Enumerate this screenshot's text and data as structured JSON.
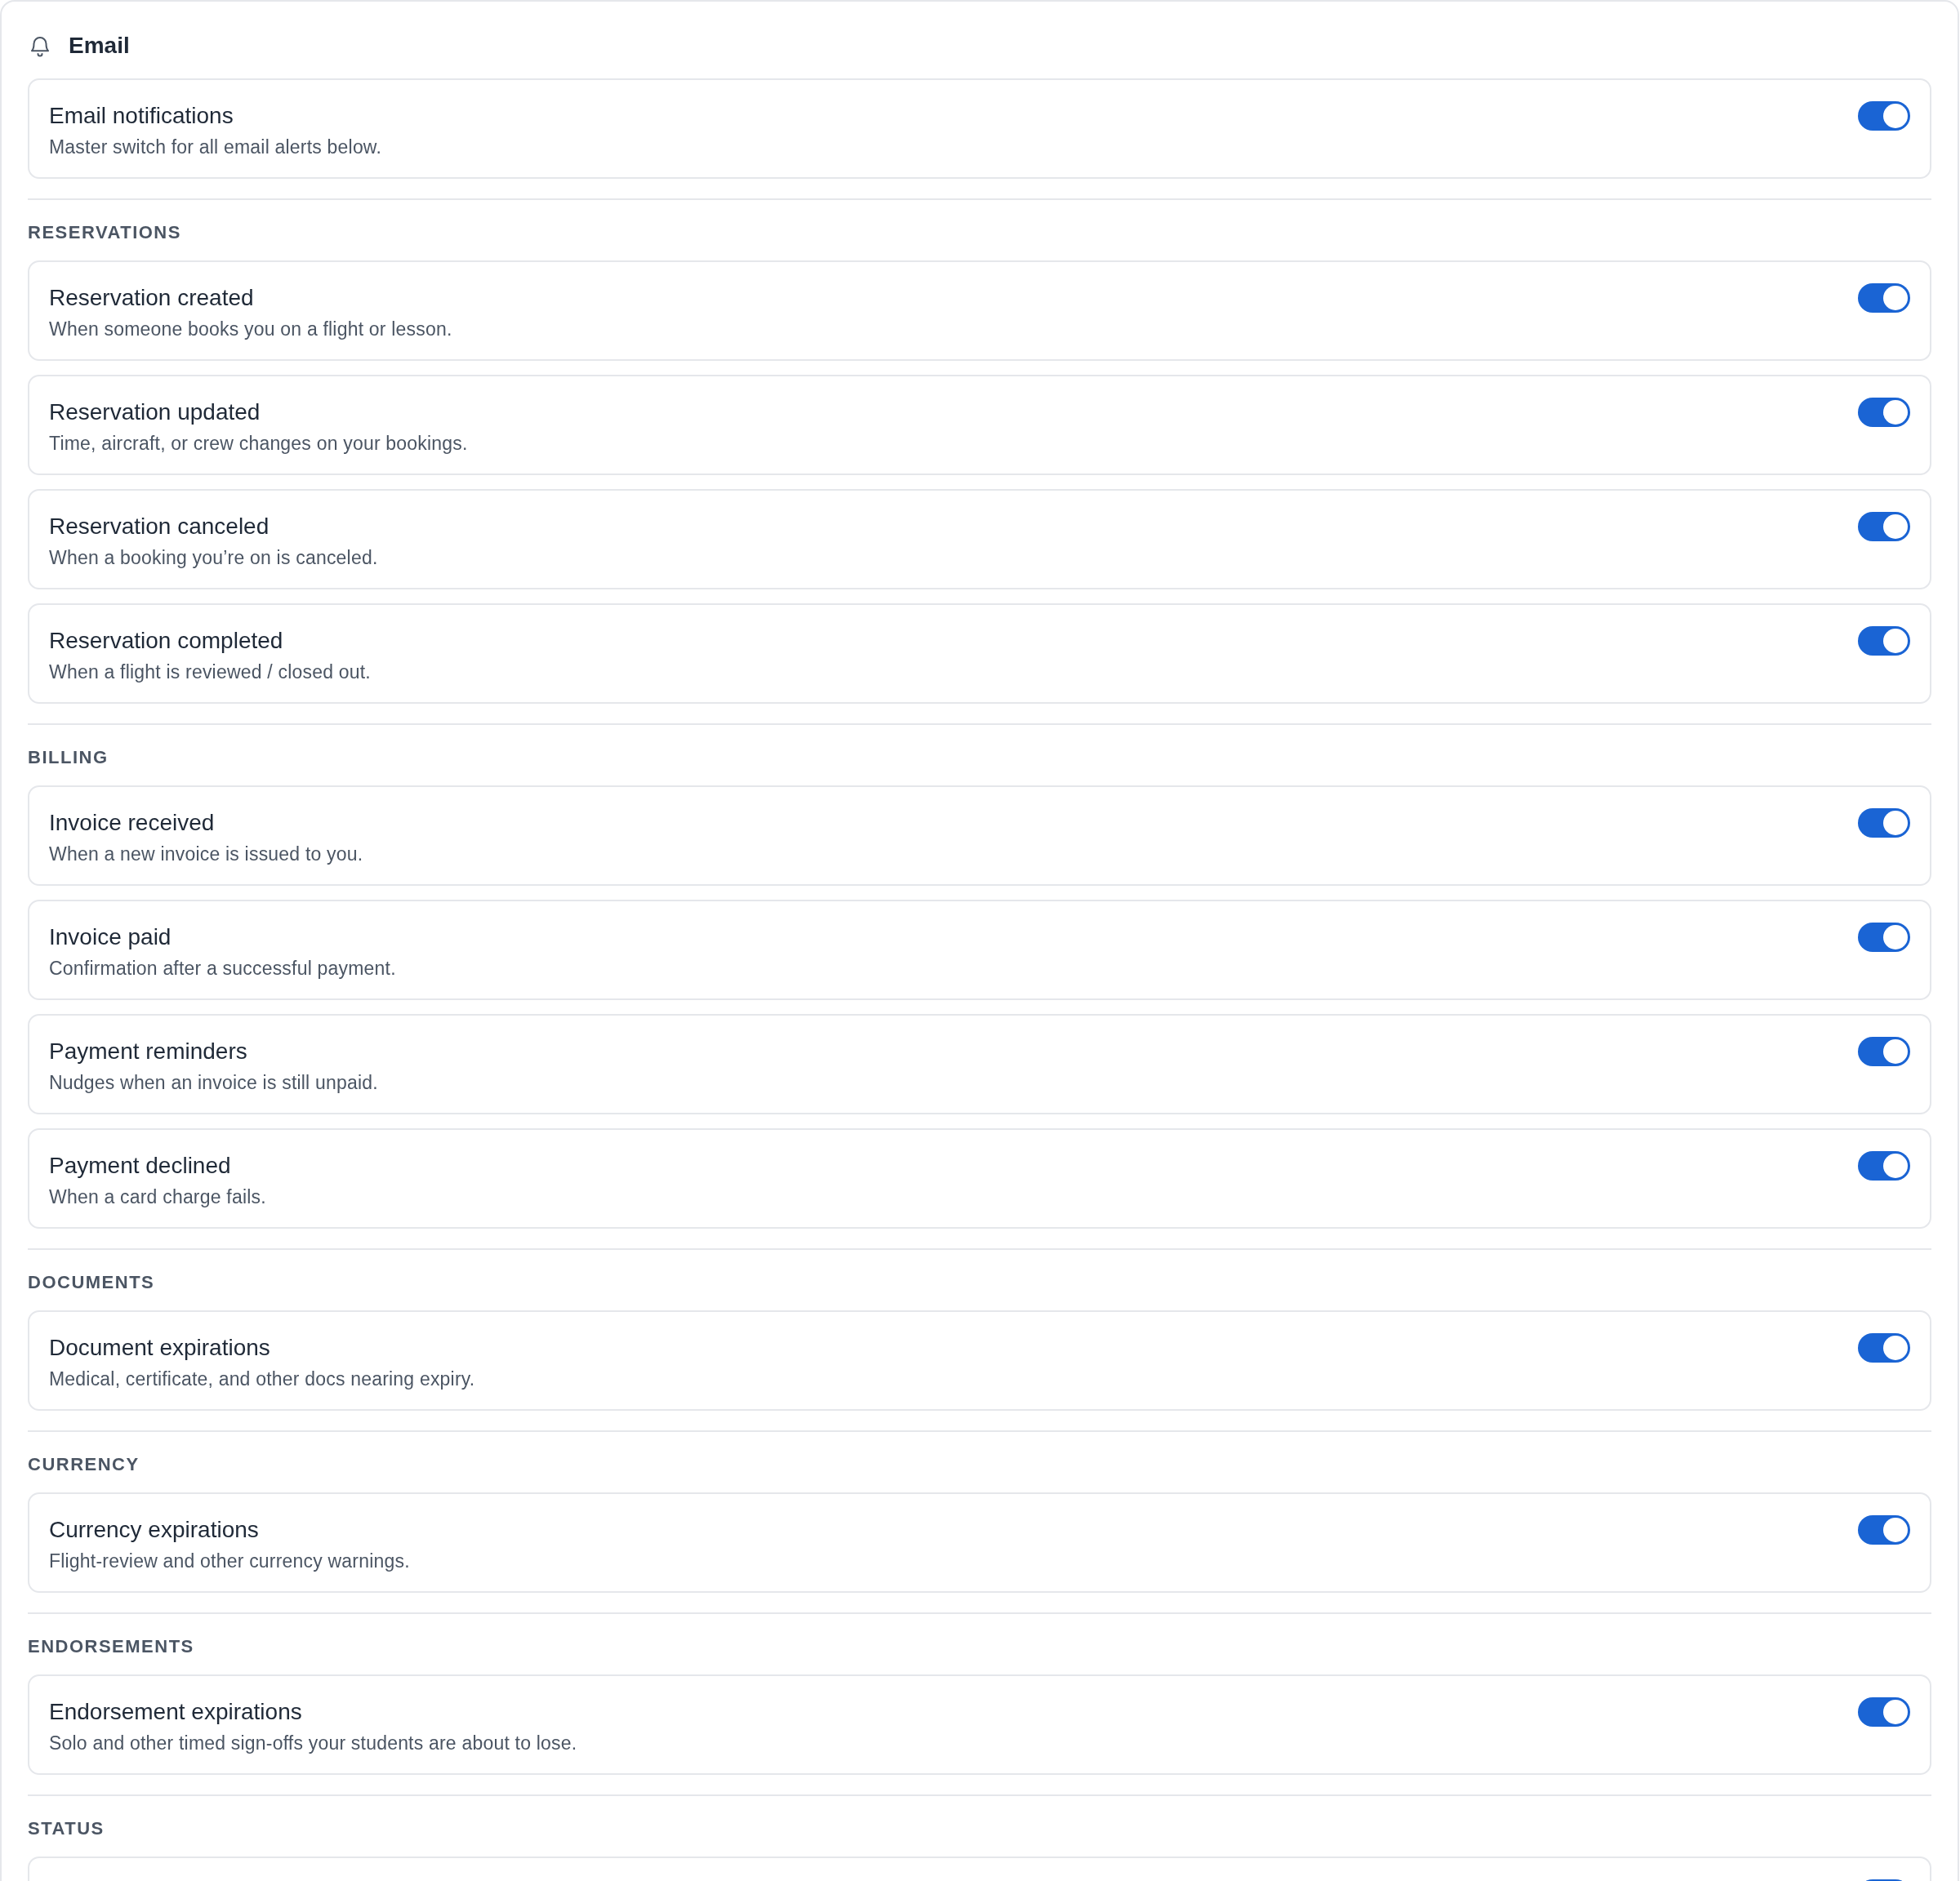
{
  "header": {
    "title": "Email"
  },
  "master": {
    "title": "Email notifications",
    "description": "Master switch for all email alerts below.",
    "on": true
  },
  "sections": [
    {
      "label": "RESERVATIONS",
      "items": [
        {
          "title": "Reservation created",
          "description": "When someone books you on a flight or lesson.",
          "on": true
        },
        {
          "title": "Reservation updated",
          "description": "Time, aircraft, or crew changes on your bookings.",
          "on": true
        },
        {
          "title": "Reservation canceled",
          "description": "When a booking you’re on is canceled.",
          "on": true
        },
        {
          "title": "Reservation completed",
          "description": "When a flight is reviewed / closed out.",
          "on": true
        }
      ]
    },
    {
      "label": "BILLING",
      "items": [
        {
          "title": "Invoice received",
          "description": "When a new invoice is issued to you.",
          "on": true
        },
        {
          "title": "Invoice paid",
          "description": "Confirmation after a successful payment.",
          "on": true
        },
        {
          "title": "Payment reminders",
          "description": "Nudges when an invoice is still unpaid.",
          "on": true
        },
        {
          "title": "Payment declined",
          "description": "When a card charge fails.",
          "on": true
        }
      ]
    },
    {
      "label": "DOCUMENTS",
      "items": [
        {
          "title": "Document expirations",
          "description": "Medical, certificate, and other docs nearing expiry.",
          "on": true
        }
      ]
    },
    {
      "label": "CURRENCY",
      "items": [
        {
          "title": "Currency expirations",
          "description": "Flight-review and other currency warnings.",
          "on": true
        }
      ]
    },
    {
      "label": "ENDORSEMENTS",
      "items": [
        {
          "title": "Endorsement expirations",
          "description": "Solo and other timed sign-offs your students are about to lose.",
          "on": true
        }
      ]
    },
    {
      "label": "STATUS",
      "items": [
        {
          "on": true
        }
      ]
    }
  ]
}
